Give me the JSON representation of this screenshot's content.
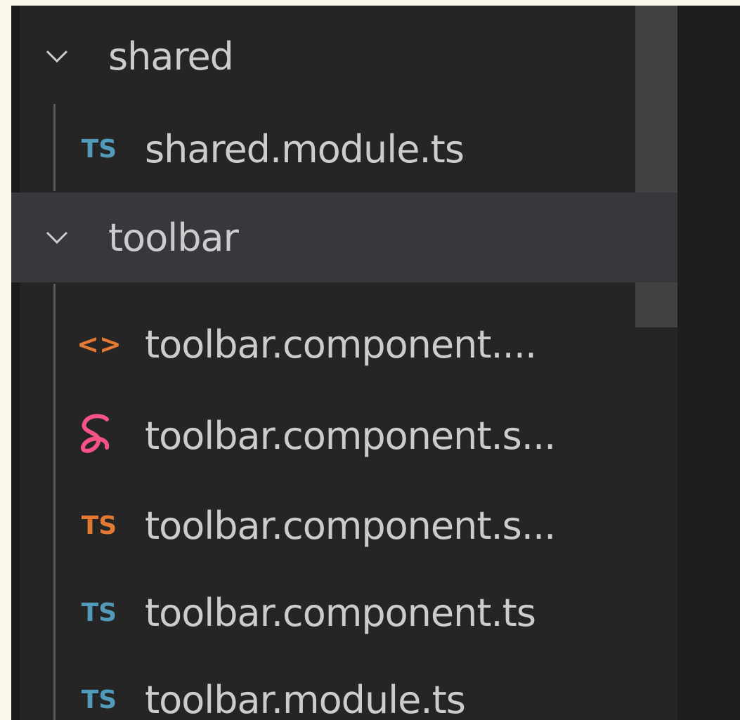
{
  "explorer": {
    "folders": [
      {
        "name": "shared",
        "expanded": true,
        "icon": "chevron-down-icon",
        "files": [
          {
            "name": "shared.module.ts",
            "icon": "typescript-icon",
            "icon_text": "TS",
            "icon_color": "#519aba"
          }
        ]
      },
      {
        "name": "toolbar",
        "expanded": true,
        "selected": true,
        "icon": "chevron-down-icon",
        "files": [
          {
            "name": "toolbar.component....",
            "icon": "html-icon",
            "icon_text": "<>",
            "icon_color": "#e37933"
          },
          {
            "name": "toolbar.component.s...",
            "icon": "sass-icon",
            "icon_color": "#f55385"
          },
          {
            "name": "toolbar.component.s...",
            "icon": "typescript-spec-icon",
            "icon_text": "TS",
            "icon_color": "#e37933"
          },
          {
            "name": "toolbar.component.ts",
            "icon": "typescript-icon",
            "icon_text": "TS",
            "icon_color": "#519aba"
          },
          {
            "name": "toolbar.module.ts",
            "icon": "typescript-icon",
            "icon_text": "TS",
            "icon_color": "#519aba"
          }
        ]
      }
    ]
  },
  "colors": {
    "background": "#252526",
    "selection": "#37373d",
    "text": "#cccccc",
    "scrollbar_thumb": "#424242"
  }
}
